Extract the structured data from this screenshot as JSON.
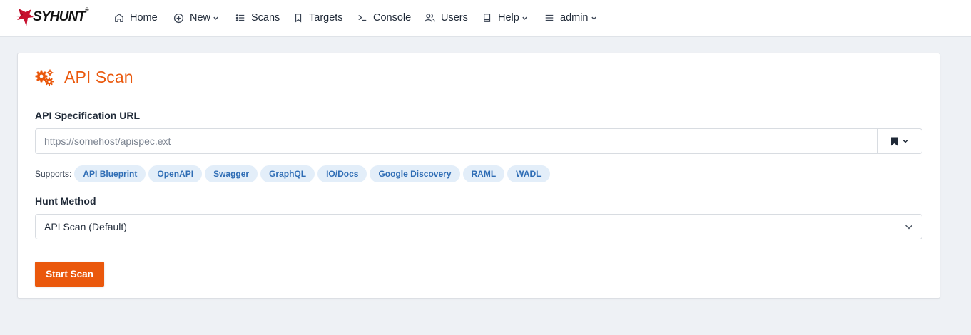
{
  "brand": {
    "name": "SYHUNT",
    "mark": "®"
  },
  "nav": [
    {
      "label": "Home",
      "icon": "home-icon"
    },
    {
      "label": "New",
      "icon": "plus-circle-icon",
      "dropdown": true
    },
    {
      "label": "Scans",
      "icon": "list-icon"
    },
    {
      "label": "Targets",
      "icon": "bookmark-icon"
    },
    {
      "label": "Console",
      "icon": "terminal-icon"
    },
    {
      "label": "Users",
      "icon": "users-icon"
    },
    {
      "label": "Help",
      "icon": "book-icon",
      "dropdown": true
    },
    {
      "label": "admin",
      "icon": "menu-icon",
      "dropdown": true
    }
  ],
  "page": {
    "title": "API Scan",
    "title_icon": "gears-icon",
    "accent_color": "#ea580c"
  },
  "form": {
    "url_label": "API Specification URL",
    "url_placeholder": "https://somehost/apispec.ext",
    "url_value": "",
    "supports_label": "Supports:",
    "formats": [
      "API Blueprint",
      "OpenAPI",
      "Swagger",
      "GraphQL",
      "IO/Docs",
      "Google Discovery",
      "RAML",
      "WADL"
    ],
    "method_label": "Hunt Method",
    "method_value": "API Scan (Default)",
    "submit_label": "Start Scan"
  }
}
